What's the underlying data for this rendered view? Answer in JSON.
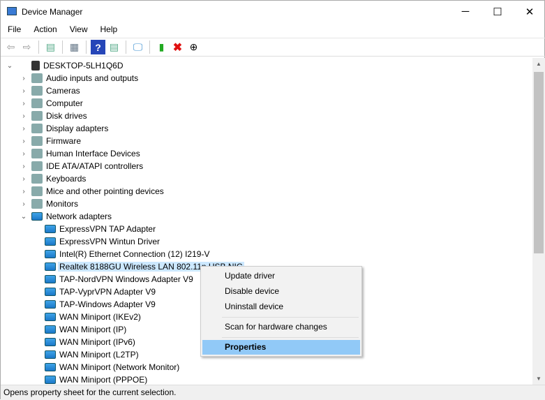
{
  "window": {
    "title": "Device Manager",
    "minimize": "─",
    "maximize": "☐",
    "close": "✕"
  },
  "menu": [
    "File",
    "Action",
    "View",
    "Help"
  ],
  "toolbar": {
    "icons": [
      "back-icon",
      "forward-icon",
      "show-hide-tree-icon",
      "properties-icon",
      "help-icon",
      "action-pane-icon",
      "scan-hardware-icon",
      "update-driver-icon",
      "uninstall-icon",
      "disable-icon"
    ]
  },
  "tree": {
    "root": "DESKTOP-5LH1Q6D",
    "categories": [
      "Audio inputs and outputs",
      "Cameras",
      "Computer",
      "Disk drives",
      "Display adapters",
      "Firmware",
      "Human Interface Devices",
      "IDE ATA/ATAPI controllers",
      "Keyboards",
      "Mice and other pointing devices",
      "Monitors",
      "Network adapters"
    ],
    "network_adapters": [
      "ExpressVPN TAP Adapter",
      "ExpressVPN Wintun Driver",
      "Intel(R) Ethernet Connection (12) I219-V",
      "Realtek 8188GU Wireless LAN 802.11n USB NIC",
      "TAP-NordVPN Windows Adapter V9",
      "TAP-VyprVPN Adapter V9",
      "TAP-Windows Adapter V9",
      "WAN Miniport (IKEv2)",
      "WAN Miniport (IP)",
      "WAN Miniport (IPv6)",
      "WAN Miniport (L2TP)",
      "WAN Miniport (Network Monitor)",
      "WAN Miniport (PPPOE)"
    ],
    "selected": "Realtek 8188GU Wireless LAN 802.11n USB NIC"
  },
  "context_menu": {
    "items": [
      "Update driver",
      "Disable device",
      "Uninstall device",
      "Scan for hardware changes",
      "Properties"
    ],
    "highlighted": "Properties"
  },
  "status": "Opens property sheet for the current selection."
}
